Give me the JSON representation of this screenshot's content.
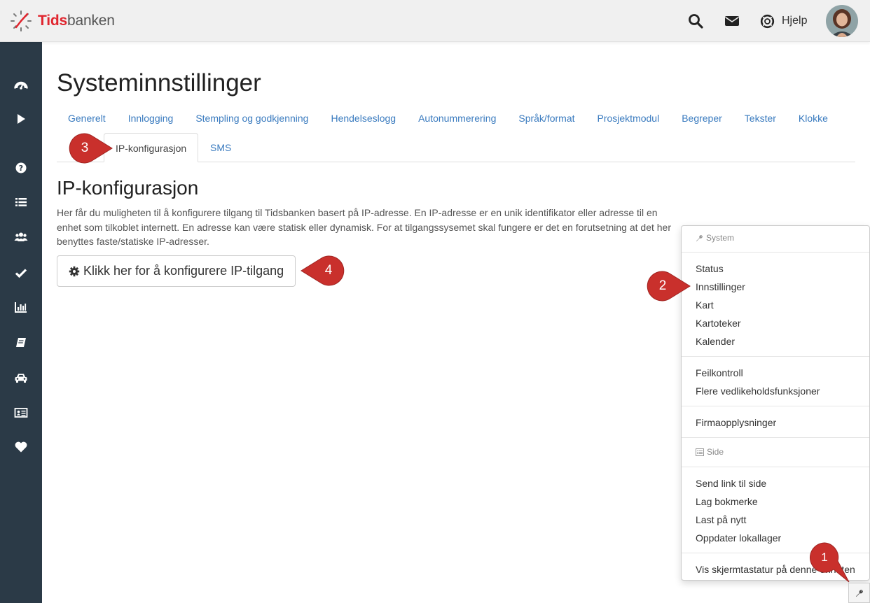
{
  "header": {
    "logo_tids": "Tids",
    "logo_banken": "banken",
    "help_label": "Hjelp",
    "icons": [
      "search-icon",
      "envelope-icon",
      "lifebuoy-icon"
    ]
  },
  "sidebar": {
    "icons": [
      "dashboard-icon",
      "play-icon",
      "help-icon",
      "list-icon",
      "users-icon",
      "check-icon",
      "bar-chart-icon",
      "book-icon",
      "car-icon",
      "id-card-icon",
      "heart-icon"
    ]
  },
  "page": {
    "title": "Systeminnstillinger",
    "tabs": [
      "Generelt",
      "Innlogging",
      "Stempling og godkjenning",
      "Hendelseslogg",
      "Autonummerering",
      "Språk/format",
      "Prosjektmodul",
      "Begreper",
      "Tekster",
      "Klokke"
    ],
    "active_tab": "IP-konfigurasjon",
    "tab_sms": "SMS"
  },
  "content": {
    "heading": "IP-konfigurasjon",
    "description": "Her får du muligheten til å konfigurere tilgang til Tidsbanken basert på IP-adresse. En IP-adresse er en unik identifikator eller adresse til en enhet som tilkoblet internett. En adresse kan være statisk eller dynamisk. For at tilgangssysemet skal fungere er det en forutsetning at det her benyttes faste/statiske IP-adresser.",
    "configure_button": "Klikk her for å konfigurere IP-tilgang"
  },
  "dropdown": {
    "system_header": "System",
    "system_items": [
      "Status",
      "Innstillinger",
      "Kart",
      "Kartoteker",
      "Kalender"
    ],
    "maintenance_items": [
      "Feilkontroll",
      "Flere vedlikeholdsfunksjoner"
    ],
    "company_item": "Firmaopplysninger",
    "page_header": "Side",
    "page_items": [
      "Send link til side",
      "Lag bokmerke",
      "Last på nytt",
      "Oppdater lokallager"
    ],
    "keyboard_item": "Vis skjermtastatur på denne enheten"
  },
  "annotations": {
    "pin1": "1",
    "pin2": "2",
    "pin3": "3",
    "pin4": "4",
    "color": "#c9302c"
  },
  "colors": {
    "brand_red": "#e0262f",
    "sidebar": "#2b3a47",
    "link": "#3a7bbf"
  }
}
